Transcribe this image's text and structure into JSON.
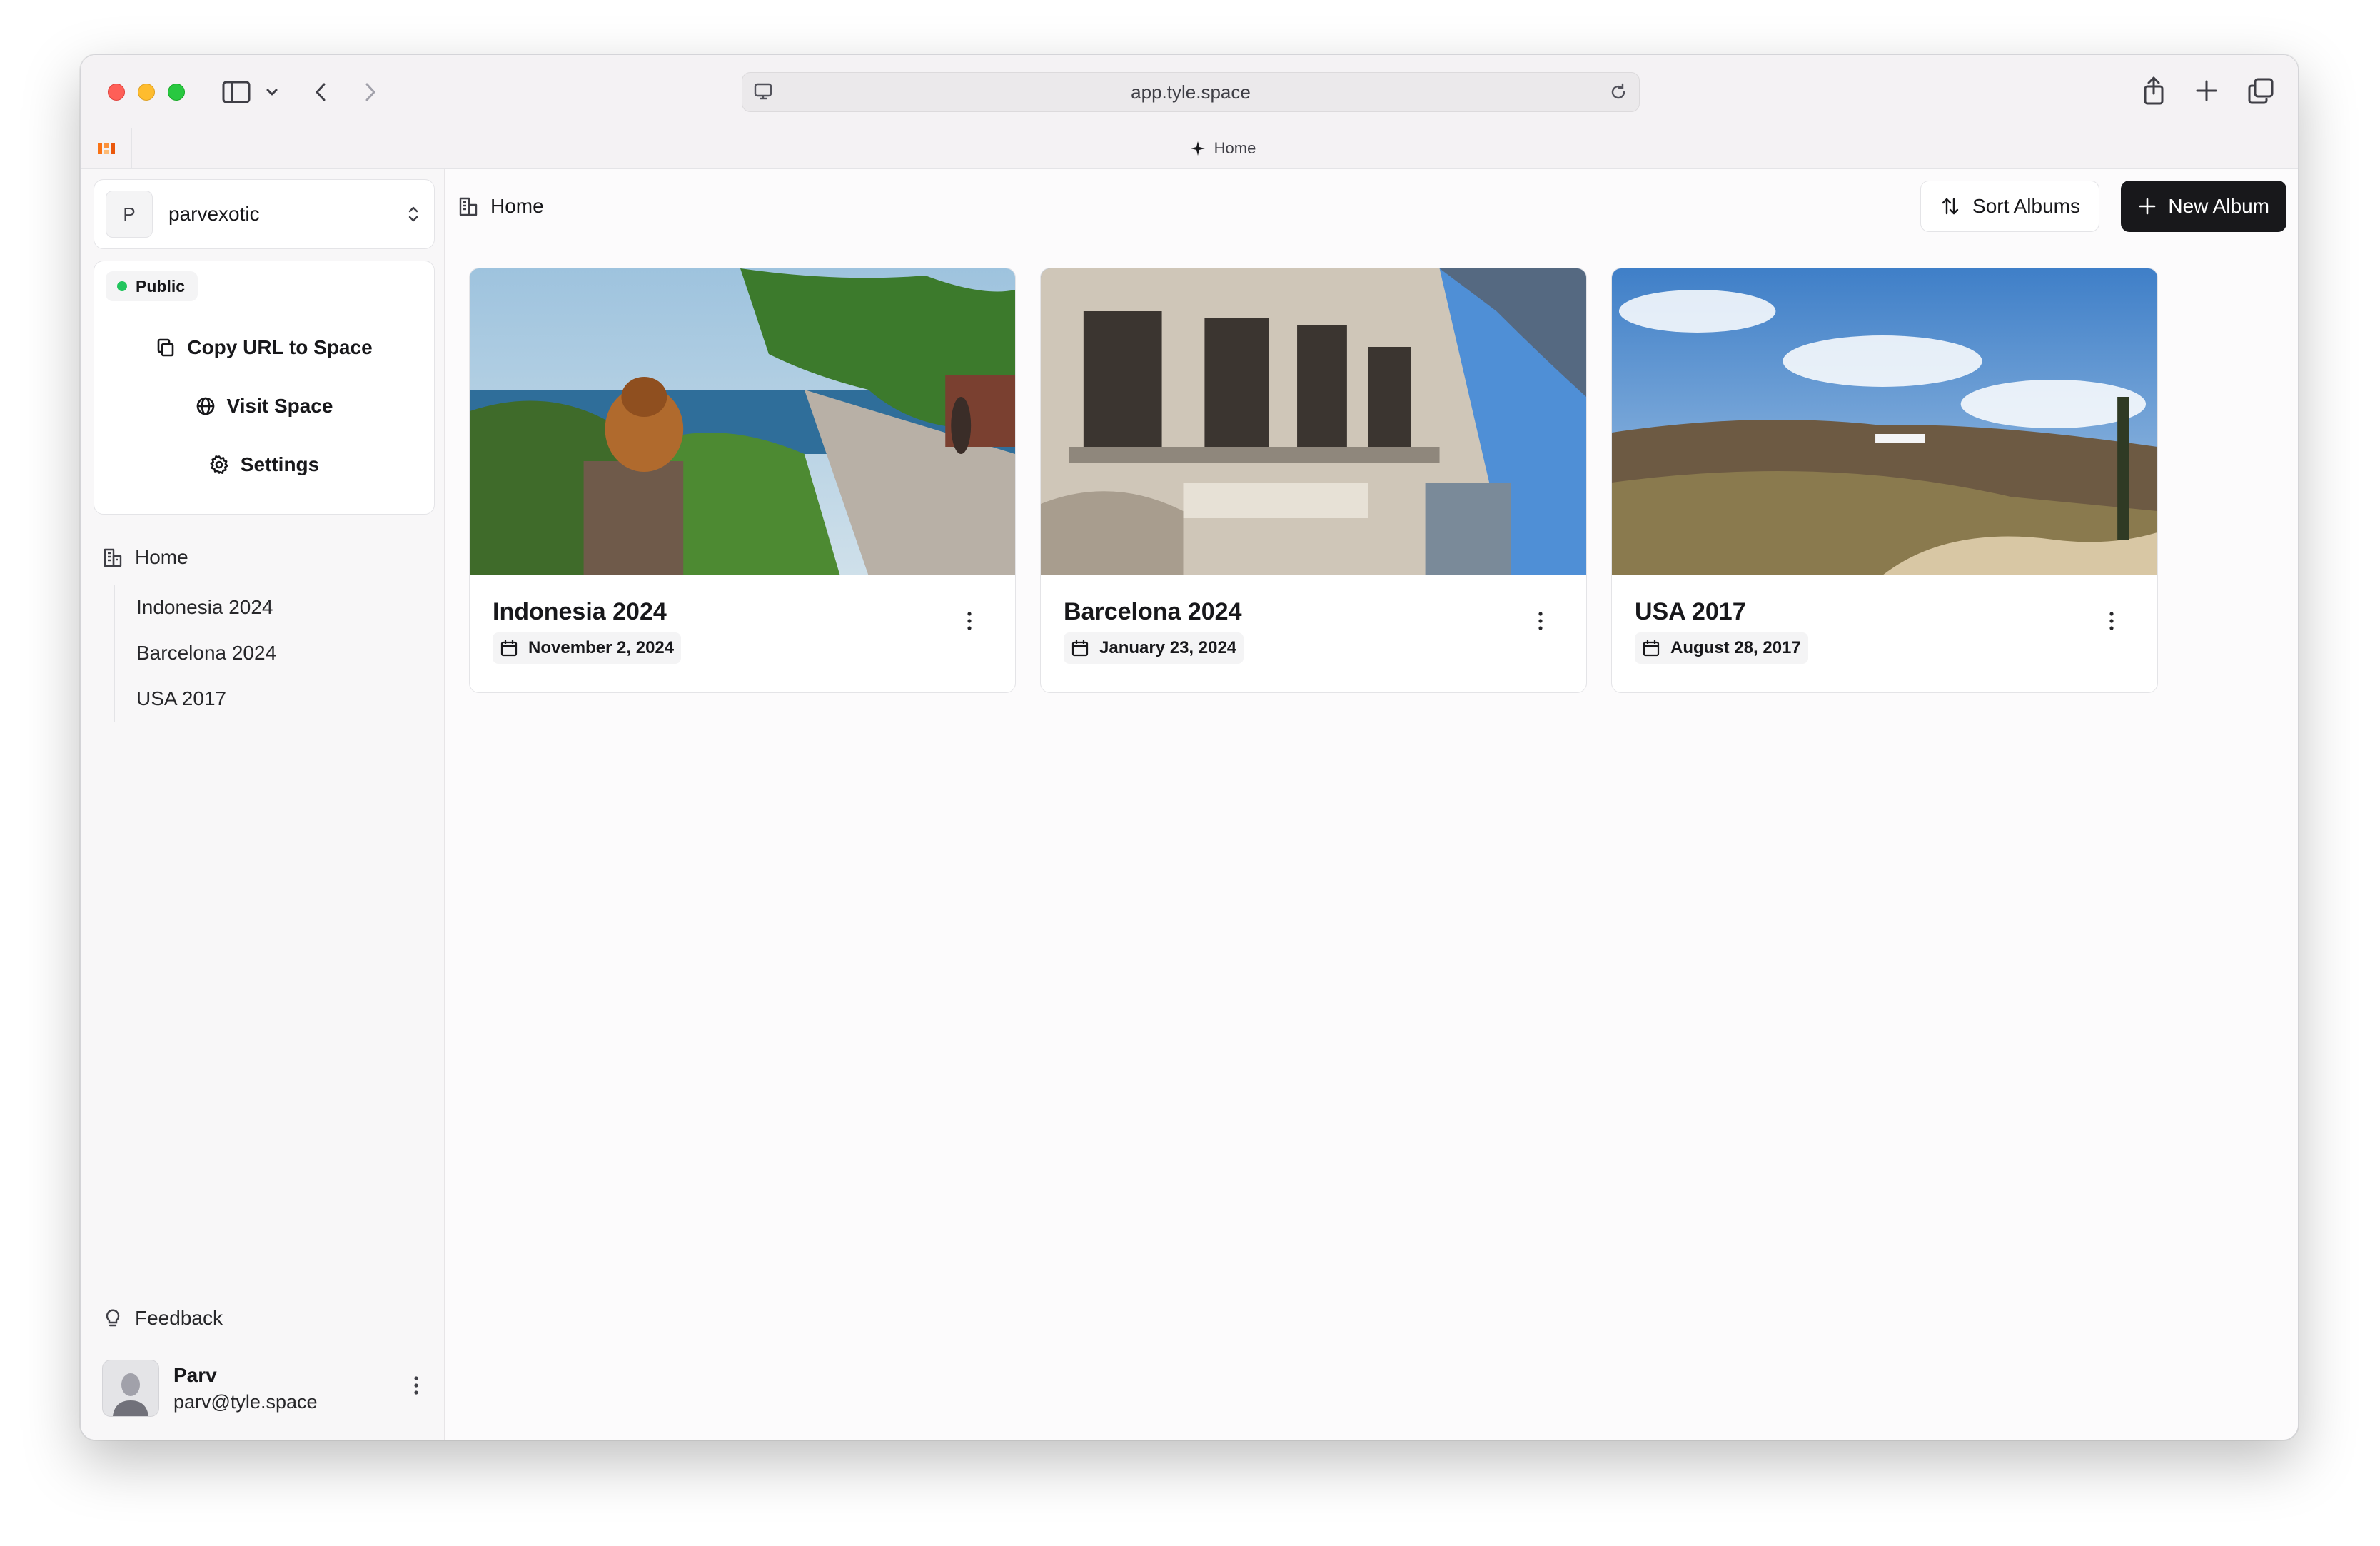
{
  "browser": {
    "url": "app.tyle.space",
    "active_tab_title": "Home"
  },
  "sidebar": {
    "space": {
      "avatar_letter": "P",
      "name": "parvexotic"
    },
    "visibility_badge": "Public",
    "actions": {
      "copy_url": "Copy URL to Space",
      "visit": "Visit Space",
      "settings": "Settings"
    },
    "nav": {
      "home": "Home",
      "albums": [
        "Indonesia 2024",
        "Barcelona 2024",
        "USA 2017"
      ]
    },
    "feedback": "Feedback",
    "user": {
      "name": "Parv",
      "email": "parv@tyle.space"
    }
  },
  "header": {
    "breadcrumb": "Home",
    "sort_button": "Sort Albums",
    "new_button": "New Album"
  },
  "albums": [
    {
      "title": "Indonesia 2024",
      "date": "November 2, 2024",
      "image": "tiger-statue-coastal-cliff"
    },
    {
      "title": "Barcelona 2024",
      "date": "January 23, 2024",
      "image": "ornate-building-facade"
    },
    {
      "title": "USA 2017",
      "date": "August 28, 2017",
      "image": "hollywood-hills-sign"
    }
  ],
  "colors": {
    "accent_dark": "#18181b",
    "public_dot": "#22c55e",
    "traffic_red": "#fe5f57",
    "traffic_yellow": "#febc2e",
    "traffic_green": "#28c840"
  }
}
